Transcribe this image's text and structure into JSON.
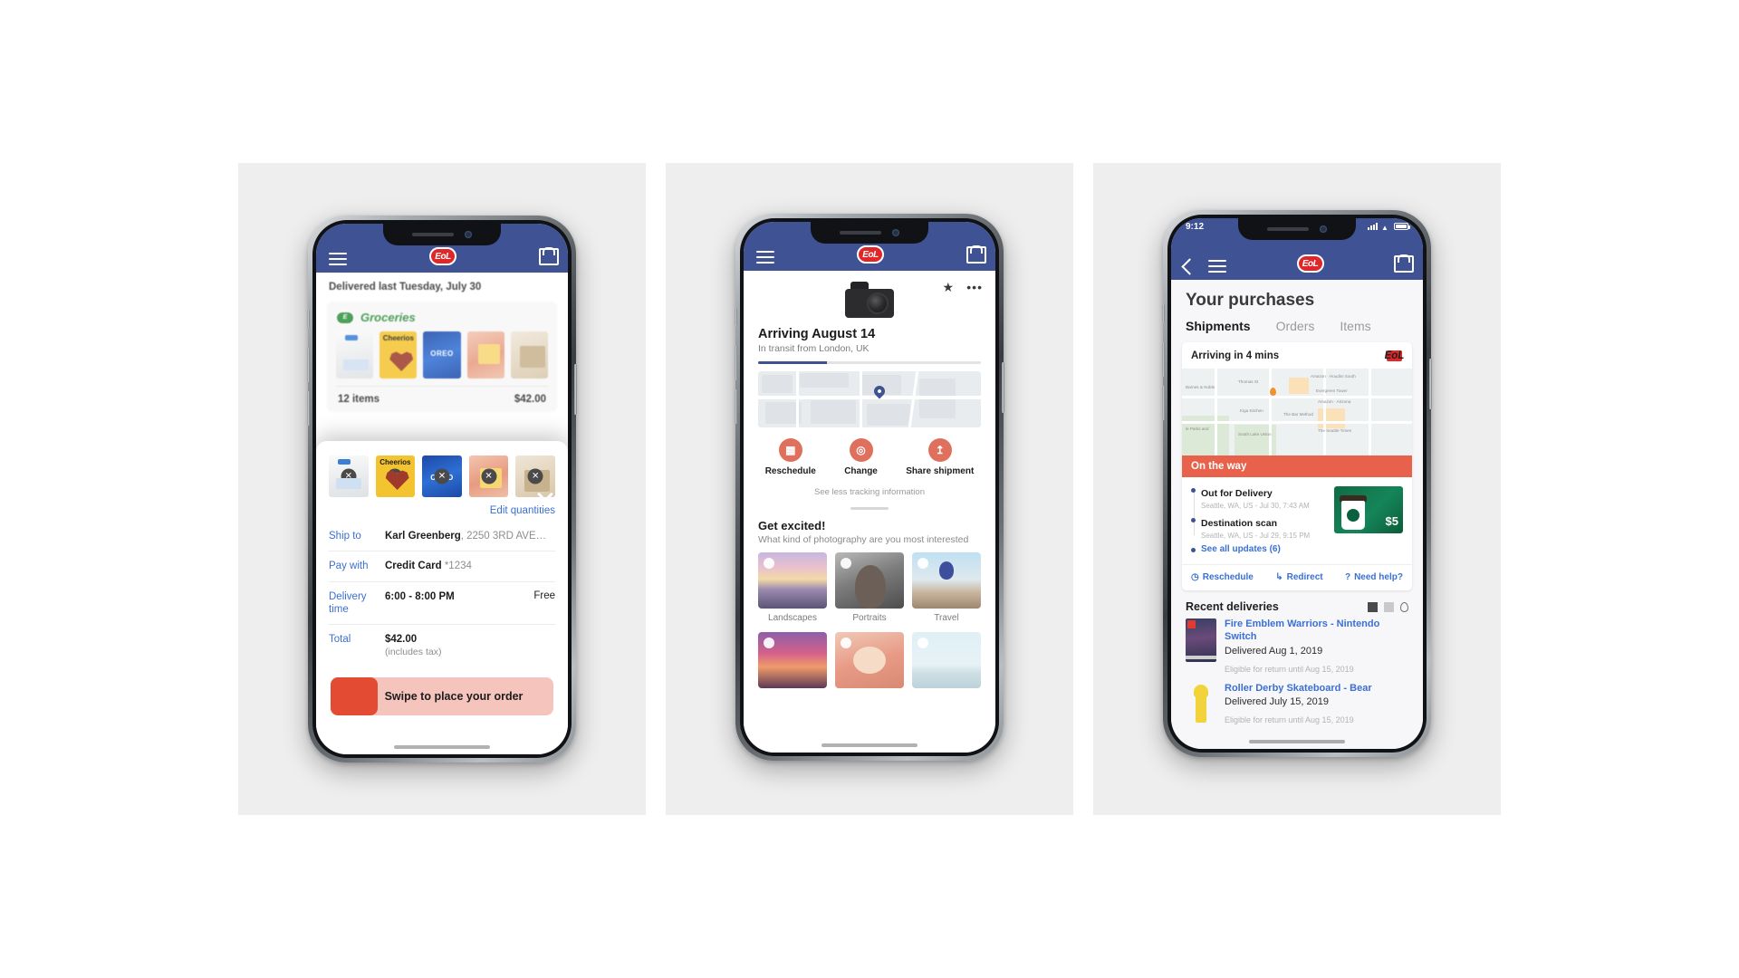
{
  "phone1": {
    "appbar": {
      "menu_icon": "hamburger-icon",
      "brand": "EoL",
      "cart_icon": "cart-icon"
    },
    "header": "Delivered last Tuesday, July 30",
    "card": {
      "category": "Groceries",
      "items_count": "12 items",
      "items_total": "$42.00",
      "thumbs": [
        "milk-jug",
        "cheerios-box",
        "oreo-thins",
        "bread-loaf",
        "grocery-bag"
      ]
    },
    "sheet": {
      "close_icon": "close-icon",
      "thumbs": [
        "milk-jug",
        "cheerios-box",
        "oreo-thins",
        "bread-loaf",
        "grocery-bag"
      ],
      "edit_quantities": "Edit quantities",
      "rows": [
        {
          "label": "Ship to",
          "value": "Karl Greenberg",
          "muted": ", 2250 3RD AVE…",
          "end": ""
        },
        {
          "label": "Pay with",
          "value": "Credit Card",
          "muted": "  *1234",
          "end": ""
        },
        {
          "label": "Delivery time",
          "value": "6:00 - 8:00 PM",
          "muted": "",
          "end": "Free"
        },
        {
          "label": "Total",
          "value": "$42.00",
          "sub": "(includes tax)",
          "end": ""
        }
      ],
      "swipe_label": "Swipe to place your order"
    }
  },
  "phone2": {
    "appbar": {
      "menu_icon": "hamburger-icon",
      "brand": "EoL",
      "cart_icon": "cart-icon"
    },
    "favorite_icon": "star-icon",
    "overflow_icon": "more-options-icon",
    "product_icon": "camera-icon",
    "title": "Arriving August 14",
    "subtitle": "In transit from London, UK",
    "progress_percent": 31,
    "map_pin_icon": "map-pin-icon",
    "actions": [
      {
        "label": "Reschedule",
        "icon": "calendar-icon",
        "glyph": "▦"
      },
      {
        "label": "Change",
        "icon": "location-pin-icon",
        "glyph": "◎"
      },
      {
        "label": "Share shipment",
        "icon": "share-icon",
        "glyph": "↥"
      }
    ],
    "see_less": "See less tracking information",
    "section_title": "Get excited!",
    "section_sub": "What kind of photography are you most interested",
    "tiles": [
      {
        "label": "Landscapes",
        "img": "landscape-photo"
      },
      {
        "label": "Portraits",
        "img": "portrait-photo"
      },
      {
        "label": "Travel",
        "img": "travel-photo"
      },
      {
        "label": "",
        "img": "city-photo"
      },
      {
        "label": "",
        "img": "food-photo"
      },
      {
        "label": "",
        "img": "beach-photo"
      }
    ]
  },
  "phone3": {
    "statusbar": {
      "time": "9:12",
      "signal_icon": "signal-icon",
      "wifi_icon": "wifi-icon",
      "battery_icon": "battery-icon"
    },
    "appbar": {
      "back_icon": "back-chevron-icon",
      "menu_icon": "hamburger-icon",
      "brand": "EoL",
      "cart_icon": "cart-icon"
    },
    "page_title": "Your purchases",
    "tabs": [
      {
        "label": "Shipments",
        "active": true
      },
      {
        "label": "Orders",
        "active": false
      },
      {
        "label": "Items",
        "active": false
      }
    ],
    "tracking": {
      "eta": "Arriving in 4 mins",
      "carrier_logo": "EoL",
      "status_banner": "On the way",
      "updates": [
        {
          "title": "Out for Delivery",
          "detail": "Seattle, WA, US - Jul 30, 7:43 AM"
        },
        {
          "title": "Destination scan",
          "detail": "Seattle, WA, US - Jul 29, 9:15 PM"
        }
      ],
      "see_all": "See all updates (6)",
      "ad": {
        "brand": "Starbucks",
        "amount": "$5"
      },
      "actions": [
        {
          "label": "Reschedule",
          "icon": "clock-icon",
          "glyph": "◷"
        },
        {
          "label": "Redirect",
          "icon": "redirect-arrow-icon",
          "glyph": "↳"
        },
        {
          "label": "Need help?",
          "icon": "help-icon",
          "glyph": "?"
        }
      ]
    },
    "recent": {
      "heading": "Recent deliveries",
      "view_icons": [
        "grid-view-icon",
        "list-view-icon",
        "map-view-icon"
      ],
      "items": [
        {
          "name": "Fire Emblem Warriors - Nintendo Switch",
          "delivered": "Delivered Aug 1, 2019",
          "eligible": "Eligible for return until Aug 15, 2019",
          "img": "game-box"
        },
        {
          "name": "Roller Derby Skateboard - Bear",
          "delivered": "Delivered July 15, 2019",
          "eligible": "Eligible for return until Aug 15, 2019",
          "img": "skateboard"
        }
      ]
    }
  }
}
